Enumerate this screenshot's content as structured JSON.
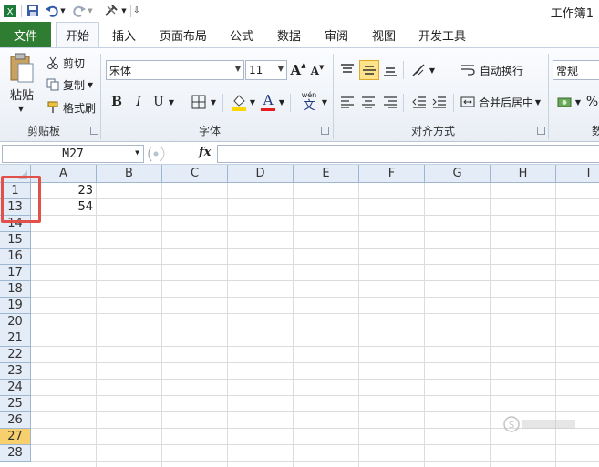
{
  "window": {
    "title": "工作簿1"
  },
  "quick_access": {
    "icons": [
      "excel-app-icon",
      "save-icon",
      "undo-icon",
      "redo-icon",
      "customize-icon"
    ]
  },
  "tabs": [
    {
      "label": "文件"
    },
    {
      "label": "开始"
    },
    {
      "label": "插入"
    },
    {
      "label": "页面布局"
    },
    {
      "label": "公式"
    },
    {
      "label": "数据"
    },
    {
      "label": "审阅"
    },
    {
      "label": "视图"
    },
    {
      "label": "开发工具"
    }
  ],
  "ribbon": {
    "clipboard": {
      "paste": "粘贴",
      "cut": "剪切",
      "copy": "复制",
      "format_painter": "格式刷",
      "label": "剪贴板"
    },
    "font": {
      "name": "宋体",
      "size": "11",
      "bold": "B",
      "italic": "I",
      "underline": "U",
      "font_color_letter": "A",
      "grow": "A",
      "shrink": "A",
      "phonetic_top": "wén",
      "phonetic_bottom": "文",
      "label": "字体",
      "fill_color": "#ffd700",
      "font_color": "#e81c1c"
    },
    "alignment": {
      "wrap_text": "自动换行",
      "merge_center": "合并后居中",
      "label": "对齐方式"
    },
    "number": {
      "format": "常规",
      "percent": "%",
      "label_partial": "数"
    }
  },
  "formula_bar": {
    "cell_ref": "M27",
    "fx": "fx",
    "formula": ""
  },
  "sheet": {
    "columns": [
      "A",
      "B",
      "C",
      "D",
      "E",
      "F",
      "G",
      "H",
      "I"
    ],
    "rows": [
      "1",
      "13",
      "14",
      "15",
      "16",
      "17",
      "18",
      "19",
      "20",
      "21",
      "22",
      "23",
      "24",
      "25",
      "26",
      "27",
      "28"
    ],
    "selected_row": "27",
    "cells": [
      {
        "row": "1",
        "col": "A",
        "value": "23"
      },
      {
        "row": "13",
        "col": "A",
        "value": "54"
      }
    ],
    "highlight_color": "#e2504a"
  }
}
